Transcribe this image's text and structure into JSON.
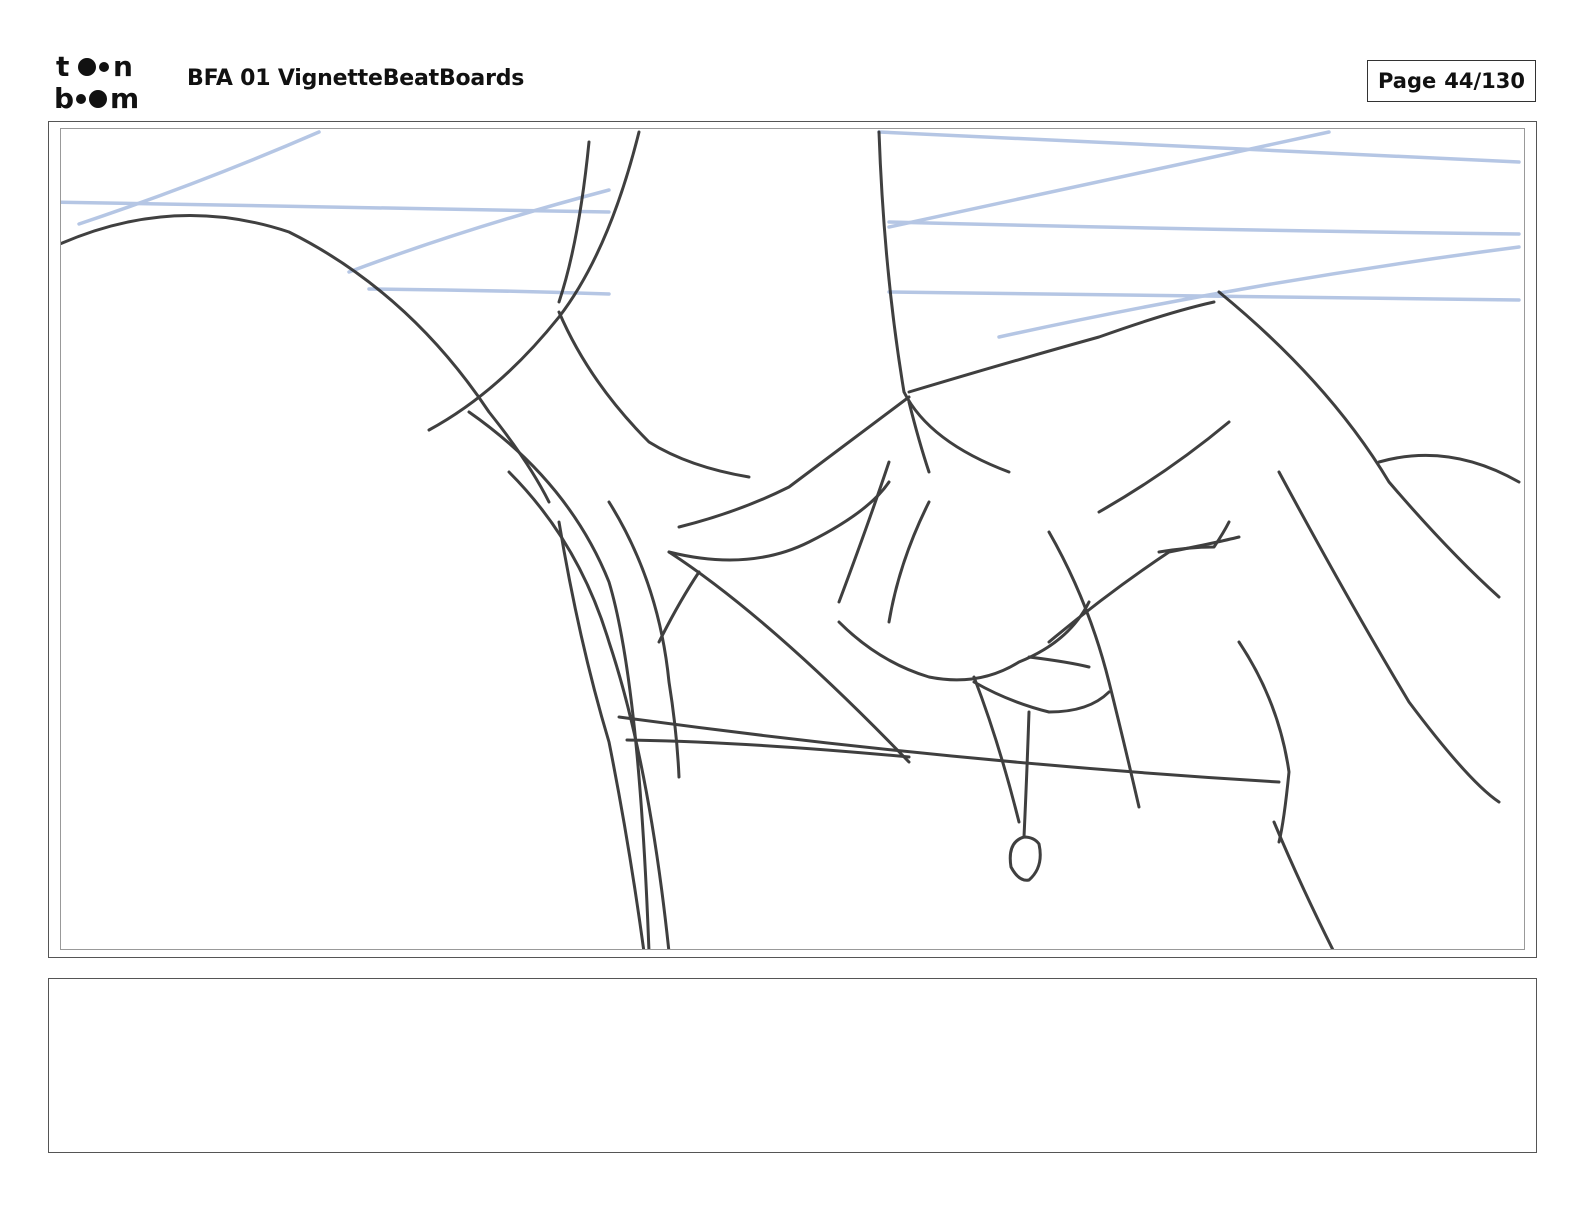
{
  "header": {
    "logo_text_top": "toon",
    "logo_text_bottom": "boom",
    "title": "BFA 01 VignetteBeatBoards",
    "page_label": "Page",
    "page_value": "44/130"
  },
  "panel": {
    "image": "rough pencil storyboard sketch with blue construction lines",
    "colors": {
      "pencil": "#2b2b2b",
      "construction": "#a9bde0",
      "frame": "#555555"
    }
  },
  "notes": {
    "text": ""
  }
}
